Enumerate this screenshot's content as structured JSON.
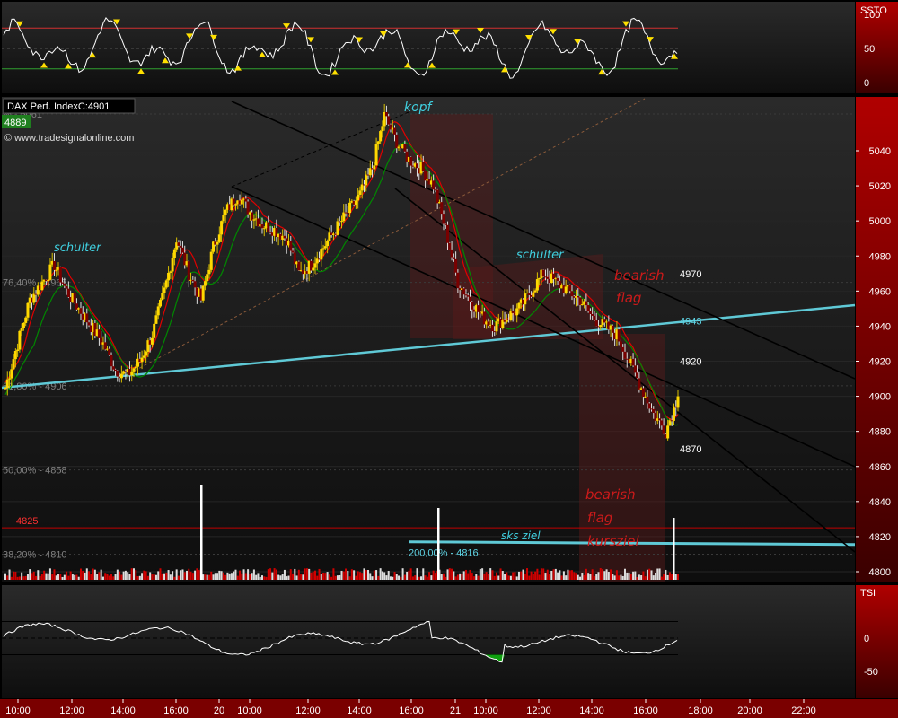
{
  "header": {
    "title": "DAX Perf. IndexC:4901",
    "last_price_badge": "4889",
    "copyright": "© www.tradesignalonline.com"
  },
  "colors": {
    "panel_bg": "#1a1a1a",
    "frame_red": "#c00000",
    "candle_up": "#ffd800",
    "candle_down": "#7a0000",
    "trendline_cyan": "#5fc9d6",
    "channel_black": "#000000",
    "ma_red": "#e00000",
    "ma_green": "#008800",
    "fib_text": "#808080",
    "annotation_cyan": "#40d0e0",
    "annotation_red": "#cc1a1a"
  },
  "chart_data": [
    {
      "panel": "oscillator-top",
      "type": "line",
      "indicator": "SSTO",
      "y_ticks": [
        "100",
        "50",
        "0"
      ],
      "levels": {
        "upper": 80,
        "lower": 20
      },
      "ylim": [
        0,
        100
      ]
    },
    {
      "panel": "price",
      "type": "candlestick",
      "ylim": [
        4795,
        5070
      ],
      "y_ticks": [
        "5040",
        "5020",
        "5000",
        "4980",
        "4960",
        "4940",
        "4920",
        "4900",
        "4880",
        "4860",
        "4840",
        "4820",
        "4800"
      ],
      "x_ticks": [
        "10:00",
        "12:00",
        "14:00",
        "16:00",
        "20",
        "10:00",
        "12:00",
        "14:00",
        "16:00",
        "21",
        "10:00",
        "12:00",
        "14:00",
        "16:00",
        "18:00",
        "20:00",
        "22:00"
      ],
      "fib_levels": [
        {
          "text": "% - 5061",
          "value": 5061
        },
        {
          "text": "76,40% - 4965",
          "value": 4965
        },
        {
          "text": "61,80% - 4906",
          "value": 4906
        },
        {
          "text": "50,00% - 4858",
          "value": 4858
        },
        {
          "text": "38,20% - 4810",
          "value": 4810
        }
      ],
      "price_labels": [
        {
          "text": "4970",
          "value": 4970
        },
        {
          "text": "4943",
          "value": 4943
        },
        {
          "text": "4920",
          "value": 4920
        },
        {
          "text": "4870",
          "value": 4870
        }
      ],
      "horizontal_lines": [
        {
          "text": "4825",
          "value": 4825
        },
        {
          "text": "200,00% - 4816",
          "value": 4816
        }
      ],
      "annotations": [
        {
          "text": "kopf",
          "color": "cyan"
        },
        {
          "text": "schulter",
          "color": "cyan",
          "position": "left"
        },
        {
          "text": "schulter",
          "color": "cyan",
          "position": "right"
        },
        {
          "text": "sks ziel",
          "color": "cyan"
        },
        {
          "text": "bearish",
          "color": "red",
          "group": "flag"
        },
        {
          "text": "flag",
          "color": "red",
          "group": "flag"
        },
        {
          "text": "bearish",
          "color": "red",
          "group": "target"
        },
        {
          "text": "flag",
          "color": "red",
          "group": "target"
        },
        {
          "text": "kursziel",
          "color": "red",
          "group": "target"
        }
      ],
      "series": [
        {
          "name": "close",
          "values": [
            4905,
            4930,
            4955,
            4965,
            4975,
            4960,
            4950,
            4940,
            4930,
            4915,
            4912,
            4920,
            4935,
            4960,
            4990,
            4970,
            4955,
            4985,
            5005,
            5015,
            5005,
            4998,
            4995,
            4990,
            4970,
            4975,
            4985,
            4995,
            5005,
            5015,
            5030,
            5060,
            5045,
            5035,
            5030,
            5020,
            4995,
            4965,
            4955,
            4945,
            4940,
            4945,
            4950,
            4960,
            4970,
            4965,
            4960,
            4955,
            4945,
            4940,
            4935,
            4920,
            4905,
            4890,
            4880,
            4900
          ]
        }
      ]
    },
    {
      "panel": "oscillator-bottom",
      "type": "line",
      "indicator": "TSI",
      "y_ticks": [
        "0",
        "-50"
      ],
      "ylim": [
        -70,
        40
      ]
    }
  ]
}
